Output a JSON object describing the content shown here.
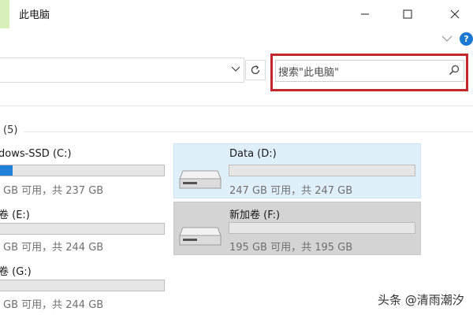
{
  "window": {
    "title": "此电脑",
    "controls": {
      "minimize": "minimize",
      "maximize": "maximize",
      "close": "close"
    },
    "help_label": "?"
  },
  "search": {
    "placeholder": "搜索\"此电脑\""
  },
  "group": {
    "header": "(5)"
  },
  "drives": [
    {
      "name": "dows-SSD (C:)",
      "space": "GB 可用，共 237 GB",
      "used_fraction": 0.09
    },
    {
      "name": "Data (D:)",
      "space": "247 GB 可用，共 247 GB",
      "used_fraction": 0.0
    },
    {
      "name": "卷 (E:)",
      "space": "GB 可用，共 244 GB",
      "used_fraction": 0.0
    },
    {
      "name": "新加卷 (F:)",
      "space": "195 GB 可用，共 195 GB",
      "used_fraction": 0.0
    },
    {
      "name": "卷 (G:)",
      "space": "GB 可用，共 244 GB",
      "used_fraction": 0.0
    }
  ],
  "watermark": "头条 @清雨潮汐",
  "colors": {
    "accent": "#1f82d8",
    "search_highlight": "#c1272d",
    "selected_tile": "#dff0fb",
    "hover_tile": "#d4d4d4"
  }
}
